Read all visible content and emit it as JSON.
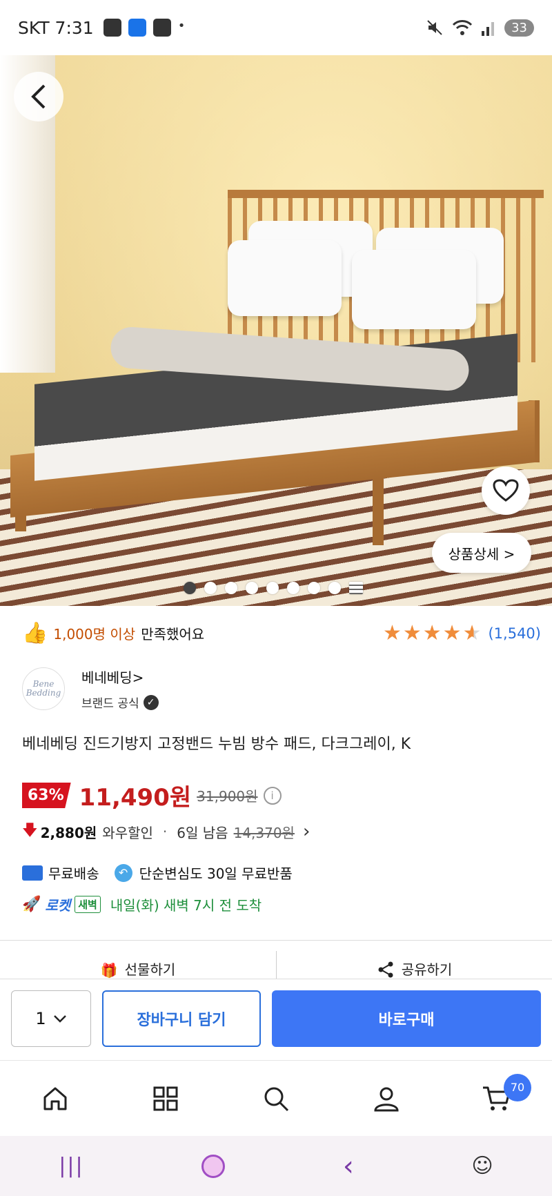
{
  "status_bar": {
    "carrier_time": "SKT 7:31",
    "battery": "33",
    "dot": "•"
  },
  "hero": {
    "detail_button": "상품상세 >",
    "image_count": 9,
    "active_index": 0
  },
  "rating": {
    "satisfied_count": "1,000명 이상",
    "satisfied_text": "만족했어요",
    "stars": 4.5,
    "review_count": "(1,540)"
  },
  "brand": {
    "logo_text": "Bene Bedding",
    "name": "베네베딩>",
    "official": "브랜드 공식"
  },
  "product": {
    "title": "베네베딩 진드기방지 고정밴드 누빔 방수 패드, 다크그레이, K"
  },
  "price": {
    "discount": "63%",
    "sale_price": "11,490원",
    "original_price": "31,900원"
  },
  "wow": {
    "price": "2,880원",
    "label": "와우할인",
    "separator": "·",
    "days_left": "6일 남음",
    "original": "14,370원"
  },
  "shipping": {
    "free_shipping": "무료배송",
    "free_return": "단순변심도 30일 무료반품",
    "rocket_label": "로켓",
    "dawn_badge": "새벽",
    "arrival": "내일(화) 새벽 7시 전 도착"
  },
  "actions": {
    "gift": "선물하기",
    "share": "공유하기"
  },
  "buybar": {
    "quantity": "1",
    "cart_button": "장바구니 담기",
    "buy_button": "바로구매"
  },
  "nav": {
    "cart_badge": "70"
  },
  "colors": {
    "accent_blue": "#3d76f5",
    "sale_red": "#c41d1d",
    "rocket_green": "#1e8f3b",
    "star_orange": "#f08c3a"
  }
}
